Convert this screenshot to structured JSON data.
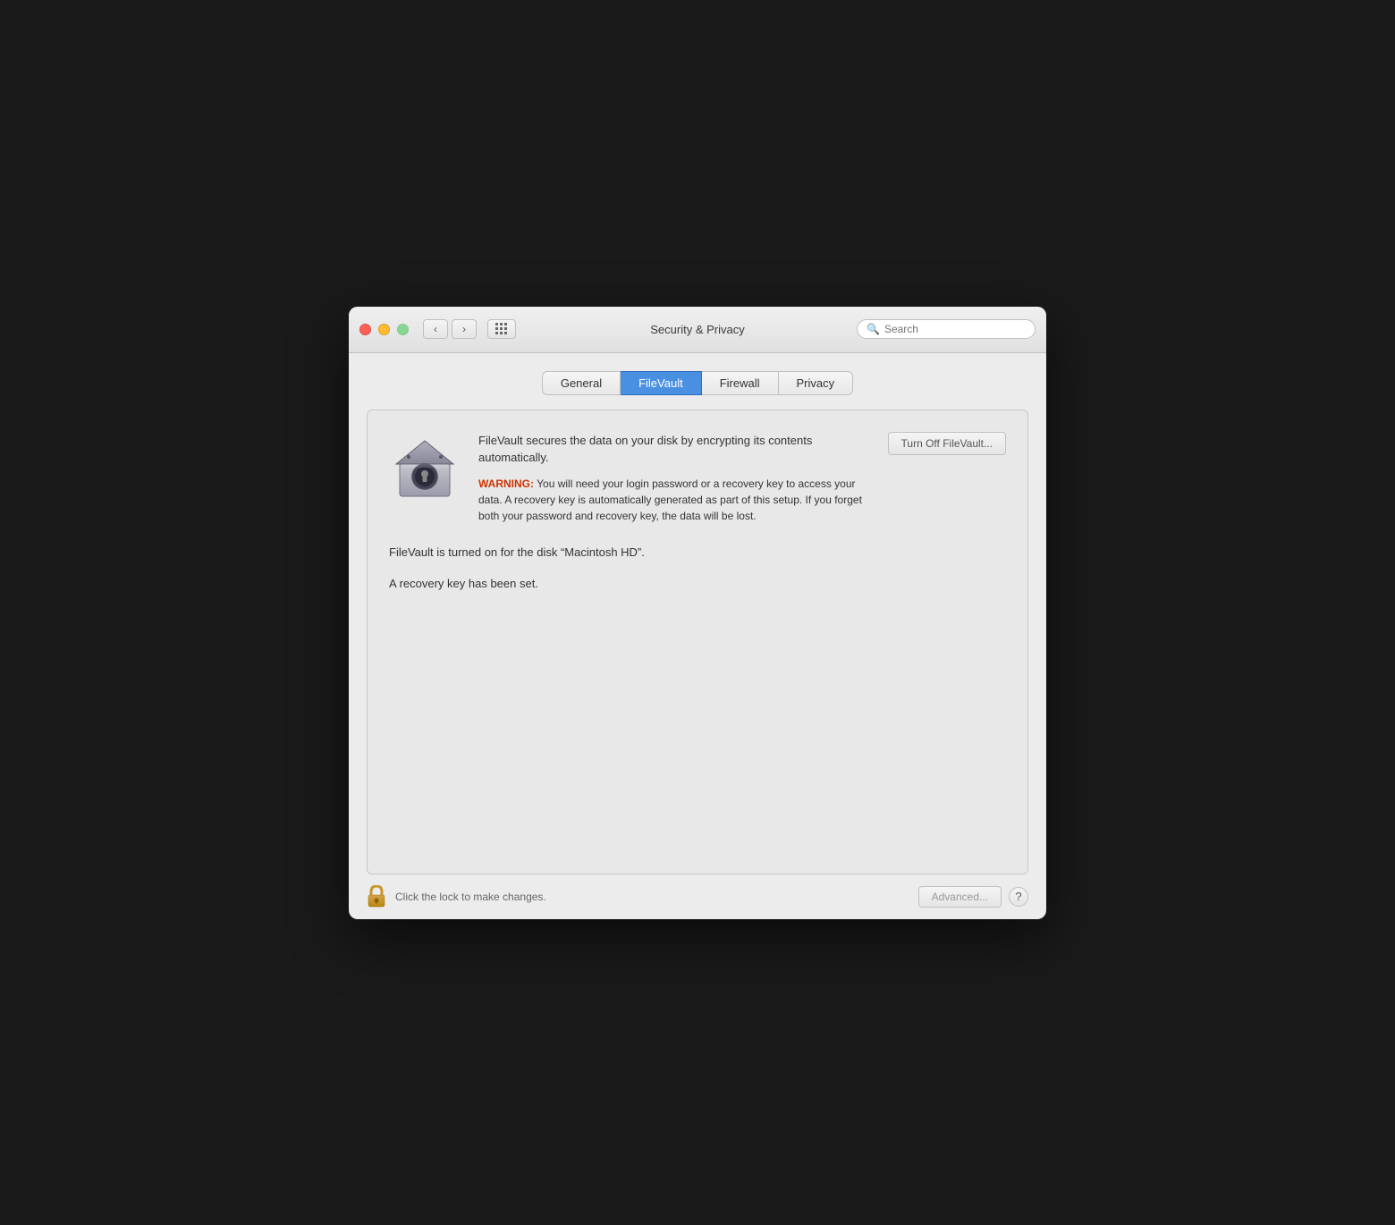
{
  "titlebar": {
    "title": "Security & Privacy",
    "search_placeholder": "Search"
  },
  "nav": {
    "back_label": "‹",
    "forward_label": "›"
  },
  "tabs": [
    {
      "id": "general",
      "label": "General",
      "active": false
    },
    {
      "id": "filevault",
      "label": "FileVault",
      "active": true
    },
    {
      "id": "firewall",
      "label": "Firewall",
      "active": false
    },
    {
      "id": "privacy",
      "label": "Privacy",
      "active": false
    }
  ],
  "filevault": {
    "description": "FileVault secures the data on your disk by encrypting its contents automatically.",
    "warning_label": "WARNING:",
    "warning_text": " You will need your login password or a recovery key to access your data. A recovery key is automatically generated as part of this setup. If you forget both your password and recovery key, the data will be lost.",
    "turn_off_button": "Turn Off FileVault...",
    "status_disk": "FileVault is turned on for the disk “Macintosh HD”.",
    "status_recovery": "A recovery key has been set."
  },
  "bottom": {
    "lock_text": "Click the lock to make changes.",
    "advanced_button": "Advanced...",
    "help_label": "?"
  }
}
